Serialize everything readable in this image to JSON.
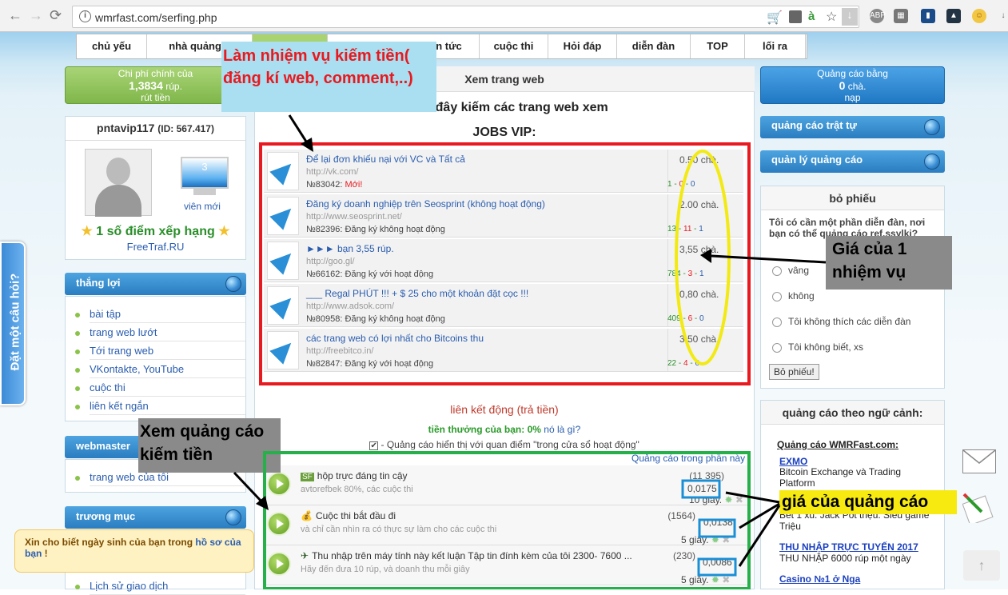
{
  "browser": {
    "url": "wmrfast.com/serfing.php"
  },
  "nav": [
    "chủ yếu",
    "nhà quảng c",
    "",
    "tin tức",
    "cuộc thi",
    "Hỏi đáp",
    "diễn đàn",
    "TOP",
    "lối ra"
  ],
  "left": {
    "main_cost": {
      "line1": "Chi phí chính của",
      "amount": "1,3834",
      "unit": "rúp.",
      "action": "rút tiền"
    },
    "user": {
      "name": "pntavip117",
      "id": "(ID: 567.417)"
    },
    "members_count": "3",
    "members_label": "viên mới",
    "rating": "1 số điểm xếp hạng",
    "freetraf": "FreeTraf.RU",
    "win_head": "thắng lợi",
    "win_items": [
      "bài tập",
      "trang web lướt",
      "Tới trang web",
      "VKontakte, YouTube",
      "cuộc thi",
      "liên kết ngắn"
    ],
    "webmaster_head": "webmaster",
    "webmaster_items": [
      "trang web của tôi"
    ],
    "catalog_head": "trương mục",
    "catalog_item": "Lịch sử giao dịch",
    "ask_tab": "Đặt một câu hỏi?",
    "birthday": {
      "text": "Xin cho biết ngày sinh của bạn trong ",
      "link": "hồ sơ của bạn",
      "tail": " !"
    }
  },
  "center": {
    "header": "Xem trang web",
    "subtitle": "Dưới đây kiếm các trang web xem",
    "jobs_title": "JOBS VIP:",
    "jobs": [
      {
        "title": "Để lại đơn khiếu nại với VC và Tất cả",
        "url": "http://vk.com/",
        "num": "№83042:",
        "status": "Mới!",
        "price": "0.50 chà.",
        "s1": "1",
        "s2": "0",
        "s3": "0"
      },
      {
        "title": "Đăng ký doanh nghiệp trên Seosprint (không hoạt động)",
        "url": "http://www.seosprint.net/",
        "num": "№82396:",
        "status": "Đăng ký không hoạt động",
        "price": "2.00 chà.",
        "s1": "13",
        "s2": "11",
        "s3": "1"
      },
      {
        "title": "►►► bạn 3,55 rúp.",
        "url": "http://goo.gl/",
        "num": "№66162:",
        "status": "Đăng ký với hoạt động",
        "price": "3,55 chà.",
        "s1": "784",
        "s2": "3",
        "s3": "1"
      },
      {
        "title": "___ Regal PHÚT !!! + $ 25 cho một khoản đặt cọc !!!",
        "url": "http://www.adsok.com/",
        "num": "№80958:",
        "status": "Đăng ký không hoạt động",
        "price": "0,80 chà.",
        "s1": "409",
        "s2": "6",
        "s3": "0"
      },
      {
        "title": "các trang web có lợi nhất cho Bitcoins thu",
        "url": "http://freebitco.in/",
        "num": "№82847:",
        "status": "Đăng ký với hoạt động",
        "price": "3.50 chà.",
        "s1": "22",
        "s2": "4",
        "s3": "0"
      }
    ],
    "dynamic_links": "liên kết động (trả tiền)",
    "bonus_label": "tiền thưởng của bạn:",
    "bonus_value": "0%",
    "bonus_q": "nó là gì?",
    "checkbox_label": "- Quảng cáo hiển thị với quan điểm \"trong cửa sổ hoạt động\"",
    "ads_link": "Quảng cáo trong phần này",
    "ads": [
      {
        "title": "hộp trực đáng tin cậy",
        "sub": "avtorefbek 80%, các cuộc thi",
        "count": "(11 395)",
        "price": "0,0175",
        "sec": "10 giây."
      },
      {
        "title": "Cuộc thi bắt đầu đi",
        "sub": "và chỉ cần nhìn ra có thực sự làm cho các cuộc thi",
        "count": "(1564)",
        "price": "0,0138",
        "sec": "5 giây."
      },
      {
        "title": "Thu nhập trên máy tính này kết luận Tập tin đính kèm của tôi 2300- 7600 ...",
        "sub": "Hãy đến đưa 10 rúp, và doanh thu mỗi giây",
        "count": "(230)",
        "price": "0,0086",
        "sec": "5 giây."
      }
    ]
  },
  "right": {
    "banner": {
      "line1": "Quảng cáo bằng",
      "amount": "0",
      "unit": "chà.",
      "action": "nạp"
    },
    "links": [
      "quảng cáo trật tự",
      "quản lý quảng cáo"
    ],
    "poll_head": "bỏ phiếu",
    "poll_q": "Tôi có cần một phần diễn đàn, nơi bạn có thể quảng cáo ref.ssylki?",
    "poll_opts": [
      "vâng",
      "không",
      "Tôi không thích các diễn đàn",
      "Tôi không biết, xs"
    ],
    "poll_btn": "Bỏ phiếu!",
    "context_head": "quảng cáo theo ngữ cảnh:",
    "context_link": "Quảng cáo WMRFast.com:",
    "ctx": [
      {
        "t": "EXMO",
        "d": "Bitcoin Exchange và Trading Platform"
      },
      {
        "t": "",
        "d": "Bet 1 xu. Jack Pot triệu. Siêu game Triệu"
      },
      {
        "t": "THU NHẬP TRỰC TUYẾN 2017",
        "d": "THU NHẬP 6000 rúp một ngày"
      },
      {
        "t": "Casino №1 ở Nga",
        "d": ""
      }
    ]
  },
  "annotations": {
    "tasks": "Làm nhiệm vụ kiếm tiền( đăng kí web, comment,..)",
    "task_price": "Giá của 1 nhiệm vụ",
    "view_ads": "Xem quảng cáo kiếm tiền",
    "ad_price": "giá của quảng cáo"
  },
  "colors": {
    "red_box": "#e8191f",
    "yellow_oval": "#f2ea12",
    "green_box": "#26b04a",
    "blue_box": "#1a8fd6"
  }
}
